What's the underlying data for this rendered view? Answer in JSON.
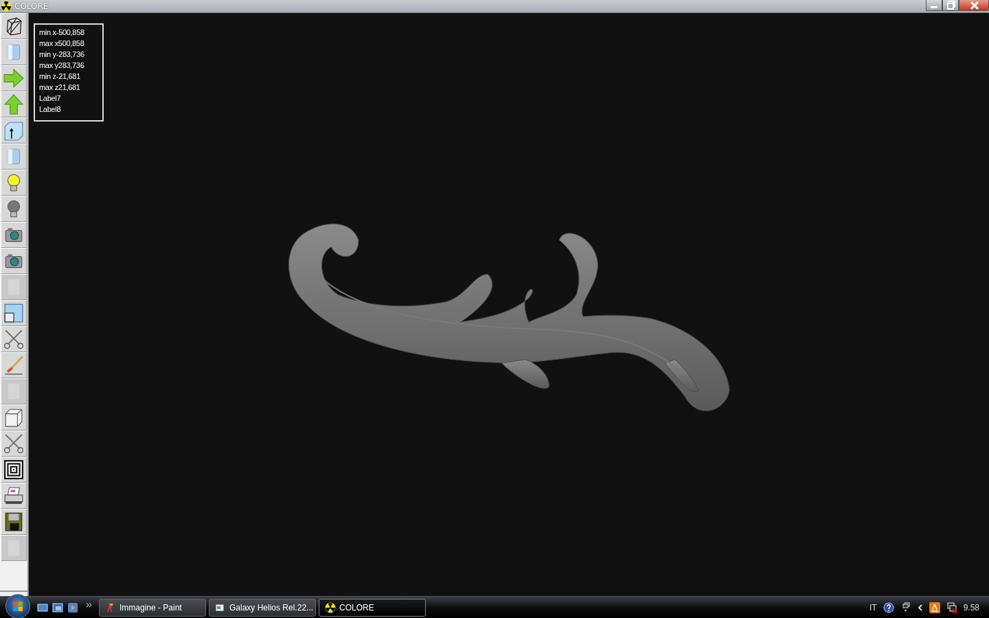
{
  "window": {
    "title": "COLORE"
  },
  "toolbar": [
    {
      "kind": "wireframe",
      "disabled": false
    },
    {
      "kind": "cylinder",
      "disabled": false
    },
    {
      "kind": "arrow-right",
      "disabled": false
    },
    {
      "kind": "arrow-up",
      "disabled": false
    },
    {
      "kind": "box-arrow",
      "disabled": false
    },
    {
      "kind": "cylinder",
      "disabled": false
    },
    {
      "kind": "bulb-on",
      "disabled": false
    },
    {
      "kind": "bulb-off",
      "disabled": false
    },
    {
      "kind": "camera",
      "disabled": false
    },
    {
      "kind": "camera",
      "disabled": false
    },
    {
      "kind": "sheet",
      "disabled": true
    },
    {
      "kind": "window",
      "disabled": false
    },
    {
      "kind": "scissors",
      "disabled": false
    },
    {
      "kind": "brush",
      "disabled": false
    },
    {
      "kind": "sheet",
      "disabled": true
    },
    {
      "kind": "cube",
      "disabled": false
    },
    {
      "kind": "scissors",
      "disabled": false
    },
    {
      "kind": "squares",
      "disabled": false
    },
    {
      "kind": "printer",
      "disabled": false
    },
    {
      "kind": "floppy",
      "disabled": false
    },
    {
      "kind": "sheet",
      "disabled": true
    }
  ],
  "info_labels": [
    "min x-500,858",
    "max x500,858",
    "min y-283,736",
    "max y283,736",
    "min z-21,681",
    "max z21,681",
    "Label7",
    "Label8"
  ],
  "taskbar": {
    "tasks": [
      {
        "kind": "paint",
        "label": "Immagine - Paint",
        "selected": false
      },
      {
        "kind": "helios",
        "label": "Galaxy Helios  Rel.22...",
        "selected": false
      },
      {
        "kind": "colore",
        "label": "COLORE",
        "selected": true
      }
    ],
    "language": "IT",
    "clock": "9.58"
  }
}
